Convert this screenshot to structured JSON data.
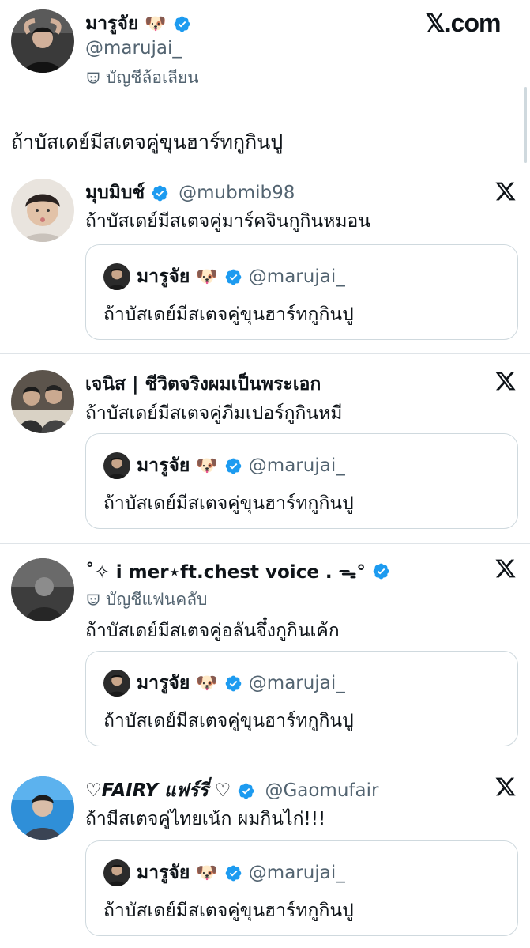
{
  "top": {
    "brand": "𝕏.com",
    "author_name": "มารูจัย",
    "author_emoji": "🐶",
    "author_handle": "@marujai_",
    "account_label": "บัญชีล้อเลียน",
    "post_text": "ถ้าบัสเดย์มีสเตจคู่ขุนฮาร์ทกูกินปู"
  },
  "quoted": {
    "name": "มารูจัย",
    "emoji": "🐶",
    "handle": "@marujai_",
    "text": "ถ้าบัสเดย์มีสเตจคู่ขุนฮาร์ทกูกินปู"
  },
  "replies": [
    {
      "name": "มุบมิบช์",
      "handle": "@mubmib98",
      "text": "ถ้าบัสเดย์มีสเตจคู่มาร์คจินกูกินหมอน"
    },
    {
      "name": "เจนิส | ชีวิตจริงผมเป็นพระเอก",
      "text": "ถ้าบัสเดย์มีสเตจคู่ภีมเปอร์กูกินหมี"
    },
    {
      "name": "˚✧ i mer⋆ft.chest voice . ᯓ°",
      "account_label": "บัญชีแฟนคลับ",
      "text": "ถ้าบัสเดย์มีสเตจคู่อลันจึ๋งกูกินเค้ก"
    },
    {
      "name": "♡FAIRY แฟร์รี่ ♡",
      "handle": "@Gaomufair",
      "text": "ถ้ามีสเตจคู่ไทยเน้ก ผมกินไก่!!!"
    }
  ],
  "colors": {
    "verified": "#1d9bf0",
    "secondary_text": "#536471",
    "border": "#cfd9de"
  },
  "icons": {
    "verified": "verified-badge-icon",
    "x_logo": "x-logo-icon",
    "mask": "theater-mask-icon"
  }
}
